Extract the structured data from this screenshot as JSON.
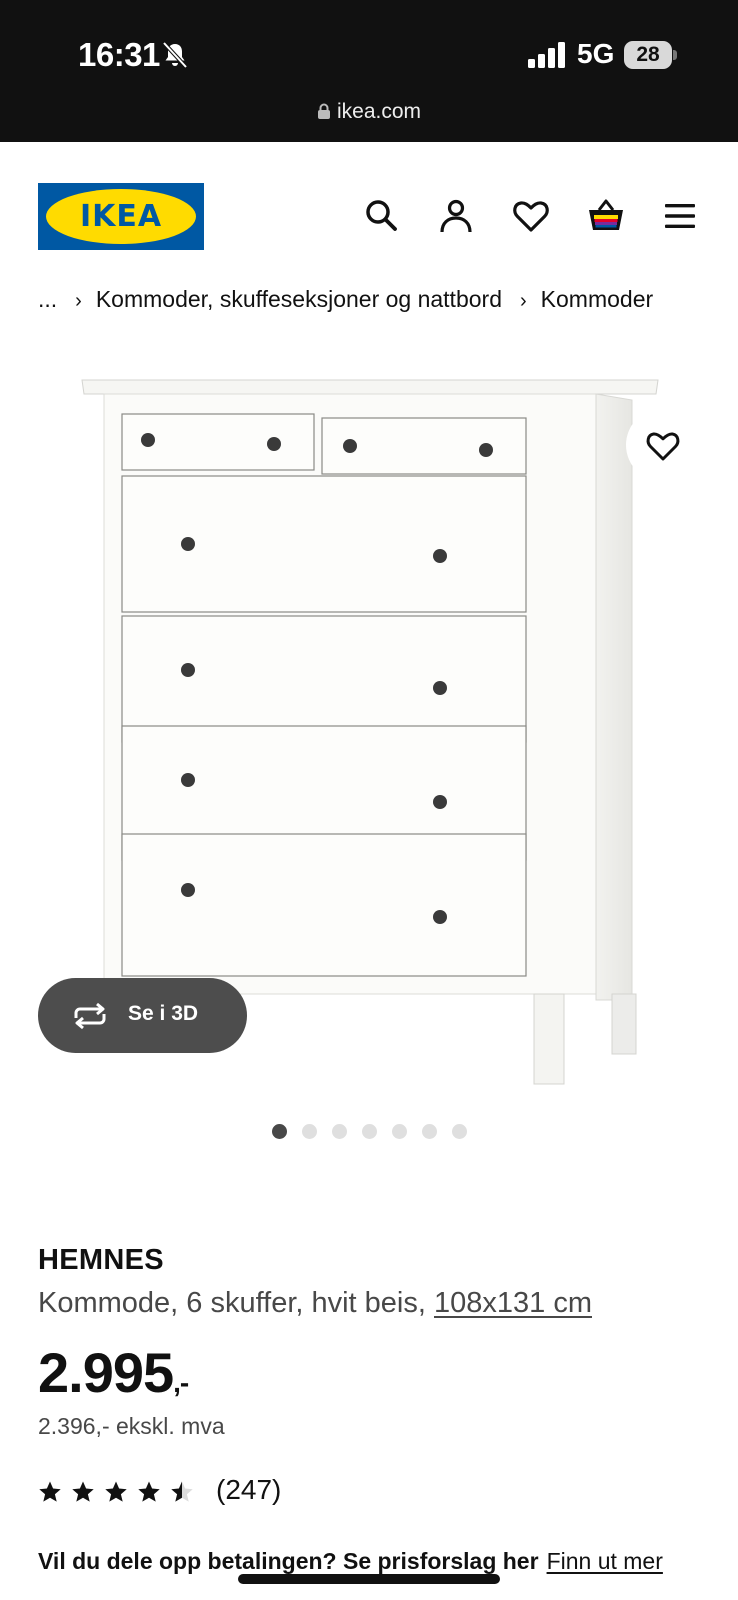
{
  "status_bar": {
    "time": "16:31",
    "network": "5G",
    "battery": "28",
    "url": "ikea.com"
  },
  "header": {
    "logo_text": "IKEA",
    "icons": [
      "search-icon",
      "account-icon",
      "heart-icon",
      "basket-icon",
      "menu-icon"
    ]
  },
  "breadcrumb": {
    "ellipsis": "...",
    "items": [
      "Kommoder, skuffeseksjoner og nattbord",
      "Kommoder"
    ]
  },
  "gallery": {
    "view_3d_label": "Se i 3D",
    "image_count": 7,
    "active_index": 0
  },
  "product": {
    "name": "HEMNES",
    "description": "Kommode, 6 skuffer, hvit beis,",
    "dimensions": "108x131 cm",
    "price": "2.995",
    "price_suffix": ",-",
    "price_excl_vat": "2.396,- ekskl. mva",
    "rating": 4.5,
    "review_count": "(247)",
    "installment_text": "Vil du dele opp betalingen? Se prisforslag her",
    "installment_link": "Finn ut mer"
  },
  "colors": {
    "ikea_blue": "#0058a3",
    "ikea_yellow": "#ffdb00",
    "status_bar_bg": "#111111"
  }
}
